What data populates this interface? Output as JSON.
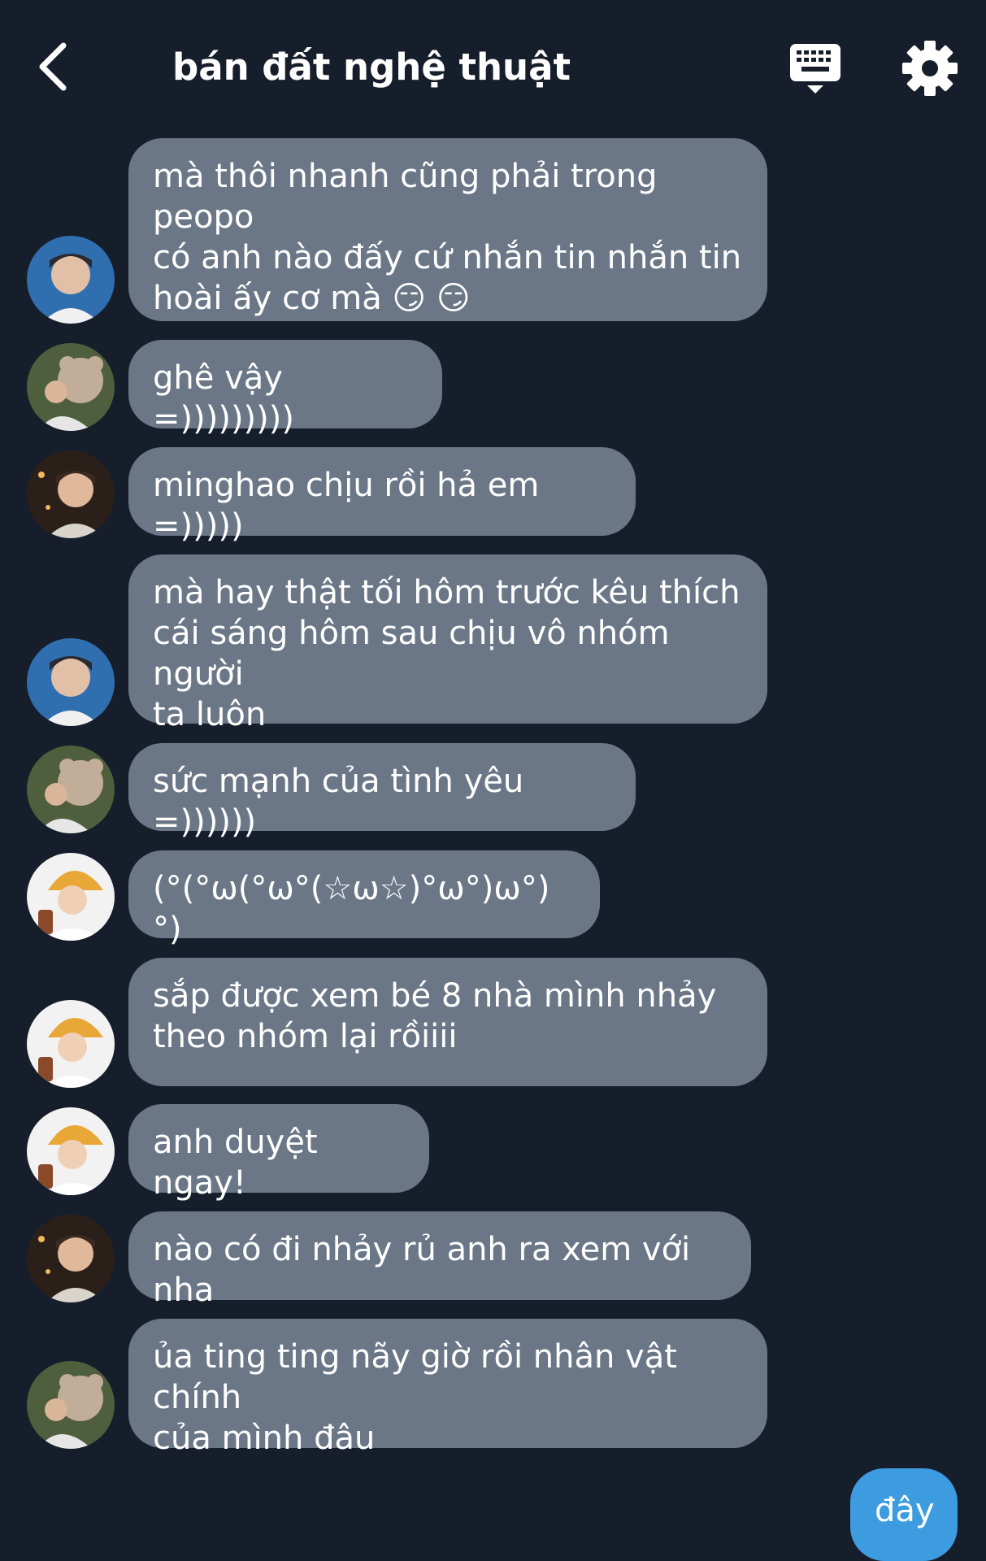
{
  "header": {
    "title": "bán đất nghệ thuật",
    "back_icon": "chevron-left-icon",
    "keyboard_icon": "keyboard-icon",
    "settings_icon": "gear-icon"
  },
  "colors": {
    "background": "#171e2b",
    "incoming_bubble": "#6b7787",
    "outgoing_bubble": "#3d9be0",
    "text": "#ffffff"
  },
  "messages": [
    {
      "sender": "avatar-a",
      "text": "mà thôi nhanh cũng phải trong peopo\ncó anh nào đấy cứ nhắn tin nhắn tin\nhoài ấy cơ mà 😏 😏"
    },
    {
      "sender": "avatar-b",
      "text": "ghê vậy =)))))))))"
    },
    {
      "sender": "avatar-c",
      "text": "minghao chịu rồi hả em =)))))"
    },
    {
      "sender": "avatar-a",
      "text": "mà hay thật tối hôm trước kêu thích\ncái sáng hôm sau chịu vô nhóm người\nta luôn"
    },
    {
      "sender": "avatar-b",
      "text": "sức mạnh của tình yêu =))))))"
    },
    {
      "sender": "avatar-d",
      "text": "(°(°ω(°ω°(☆ω☆)°ω°)ω°)°)"
    },
    {
      "sender": "avatar-d",
      "text": "sắp được xem bé 8 nhà mình nhảy\ntheo nhóm lại rồiiii"
    },
    {
      "sender": "avatar-d",
      "text": "anh duyệt ngay!"
    },
    {
      "sender": "avatar-c",
      "text": "nào có đi nhảy rủ anh ra xem với nha"
    },
    {
      "sender": "avatar-b",
      "text": "ủa ting ting nãy giờ rồi nhân vật chính\ncủa mình đâu"
    }
  ],
  "my_message": {
    "text": "đây"
  }
}
